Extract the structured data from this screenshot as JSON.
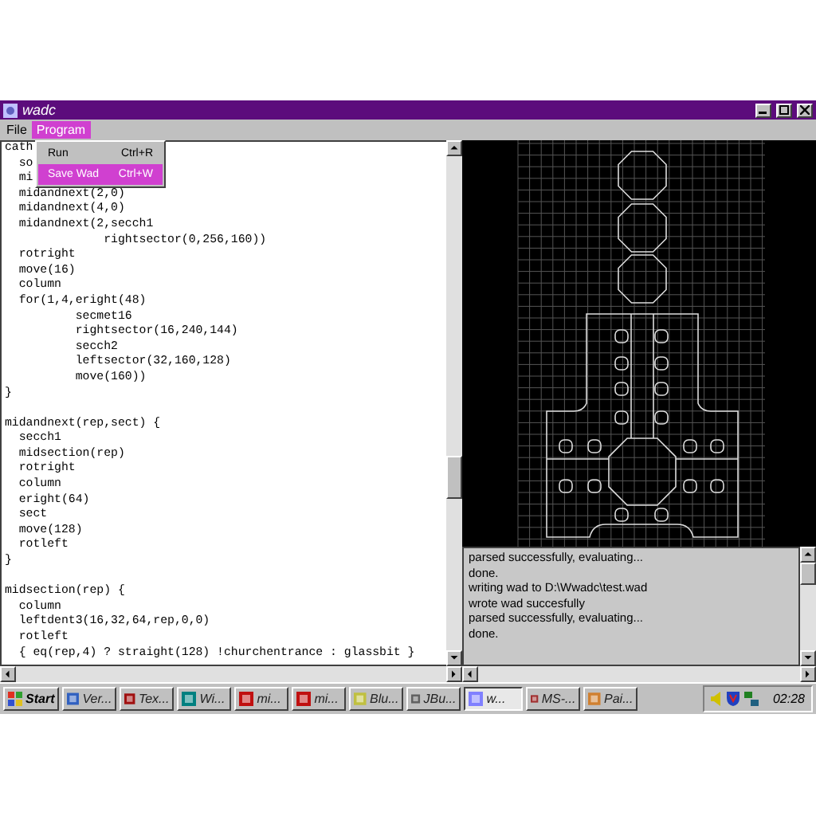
{
  "window": {
    "title": "wadc"
  },
  "menu_bar": [
    {
      "label": "File",
      "selected": false
    },
    {
      "label": "Program",
      "selected": true
    }
  ],
  "dropdown": [
    {
      "label": "Run",
      "shortcut": "Ctrl+R",
      "selected": false
    },
    {
      "label": "Save Wad",
      "shortcut": "Ctrl+W",
      "selected": true
    }
  ],
  "editor": {
    "blocks": [
      [
        "cath",
        "  so",
        "  mi",
        "  midandnext(2,0)",
        "  midandnext(4,0)",
        "  midandnext(2,secch1",
        "              rightsector(0,256,160))",
        "  rotright",
        "  move(16)",
        "  column",
        "  for(1,4,eright(48)",
        "          secmet16",
        "          rightsector(16,240,144)",
        "          secch2",
        "          leftsector(32,160,128)",
        "          move(160))",
        "}"
      ],
      [
        "midandnext(rep,sect) {",
        "  secch1",
        "  midsection(rep)",
        "  rotright",
        "  column",
        "  eright(64)",
        "  sect",
        "  move(128)",
        "  rotleft",
        "}"
      ],
      [
        "midsection(rep) {",
        "  column",
        "  leftdent3(16,32,64,rep,0,0)",
        "  rotleft",
        "  { eq(rep,4) ? straight(128) !churchentrance : glassbit }"
      ]
    ]
  },
  "log": [
    "parsed successfully, evaluating...",
    "done.",
    "writing wad to D:\\Wwadc\\test.wad",
    "wrote wad succesfully",
    "parsed successfully, evaluating...",
    "done."
  ],
  "taskbar": {
    "start": "Start",
    "tasks": [
      {
        "label": "Ver...",
        "selected": false
      },
      {
        "label": "Tex...",
        "selected": false
      },
      {
        "label": "Wi...",
        "selected": false
      },
      {
        "label": "mi...",
        "selected": false
      },
      {
        "label": "mi...",
        "selected": false
      },
      {
        "label": "Blu...",
        "selected": false
      },
      {
        "label": "JBu...",
        "selected": false
      },
      {
        "label": "w...",
        "selected": true
      },
      {
        "label": "MS-...",
        "selected": false
      },
      {
        "label": "Pai...",
        "selected": false
      }
    ],
    "clock": "02:28"
  }
}
